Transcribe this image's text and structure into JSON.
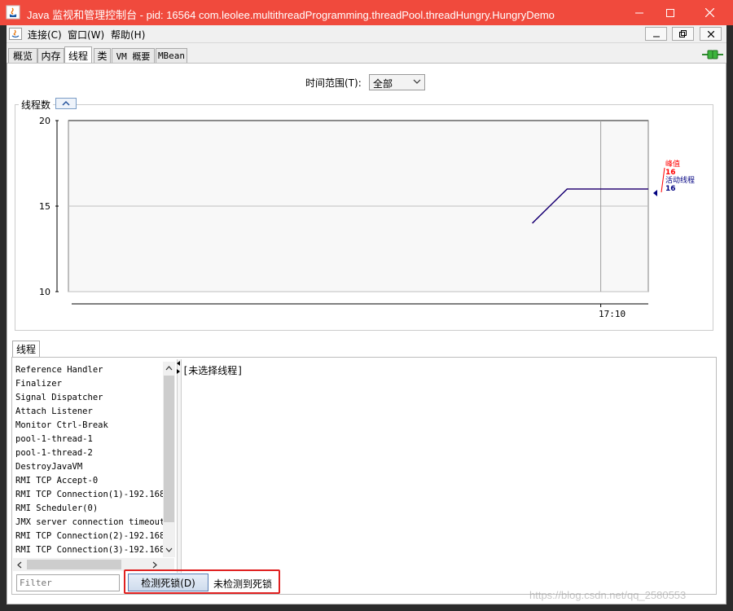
{
  "window": {
    "title": "Java 监视和管理控制台 - pid: 16564 com.leolee.multithreadProgramming.threadPool.threadHungry.HungryDemo"
  },
  "menu": {
    "items": [
      "连接(C)",
      "窗口(W)",
      "帮助(H)"
    ]
  },
  "tabs": [
    "概览",
    "内存",
    "线程",
    "类",
    "VM 概要",
    "MBean"
  ],
  "active_tab": "线程",
  "time_range": {
    "label": "时间范围(T):",
    "value": "全部"
  },
  "chart_section": {
    "title": "线程数"
  },
  "chart_data": {
    "type": "line",
    "title": "",
    "ylabel": "",
    "xlabel": "",
    "ylim": [
      10,
      20
    ],
    "yticks": [
      10,
      15,
      20
    ],
    "xticks": [
      "17:10"
    ],
    "grid": true,
    "series": [
      {
        "name": "峰值",
        "color": "#ff0000",
        "current": 16,
        "points": [
          [
            0.8,
            14
          ],
          [
            0.86,
            16
          ],
          [
            1.0,
            16
          ]
        ]
      },
      {
        "name": "活动线程",
        "color": "#000080",
        "current": 16,
        "points": [
          [
            0.8,
            14
          ],
          [
            0.86,
            16
          ],
          [
            1.0,
            16
          ]
        ]
      }
    ],
    "legend_position": "right"
  },
  "threads_tab": {
    "label": "线程"
  },
  "thread_list": [
    "Reference Handler",
    "Finalizer",
    "Signal Dispatcher",
    "Attach Listener",
    "Monitor Ctrl-Break",
    "pool-1-thread-1",
    "pool-1-thread-2",
    "DestroyJavaVM",
    "RMI TCP Accept-0",
    "RMI TCP Connection(1)-192.168.",
    "RMI Scheduler(0)",
    "JMX server connection timeout",
    "RMI TCP Connection(2)-192.168.",
    "RMI TCP Connection(3)-192.168."
  ],
  "detail": {
    "text": "[未选择线程]"
  },
  "filter": {
    "placeholder": "Filter"
  },
  "deadlock": {
    "button_label": "检测死锁(D)",
    "status": "未检测到死锁"
  },
  "watermark": "https://blog.csdn.net/qq_2580553"
}
